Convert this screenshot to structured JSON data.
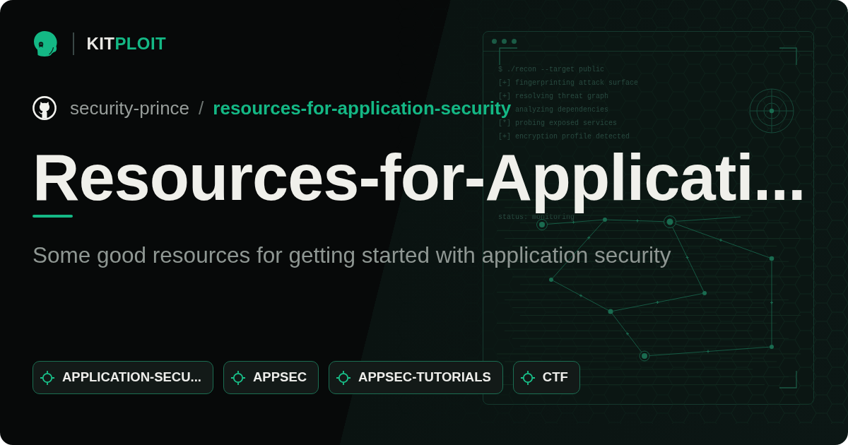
{
  "brand": {
    "prefix": "KIT",
    "suffix": "PLOIT"
  },
  "repository": {
    "owner": "security-prince",
    "separator": "/",
    "name": "resources-for-application-security"
  },
  "title": "Resources-for-Applicati...",
  "description": "Some good resources for getting started with application security",
  "topics": [
    "APPLICATION-SECU...",
    "APPSEC",
    "APPSEC-TUTORIALS",
    "CTF"
  ],
  "terminal": {
    "lines": [
      {
        "kind": "full",
        "text": "$ ./recon --target public"
      },
      {
        "kind": "full",
        "text": "[+] fingerprinting attack surface"
      },
      {
        "kind": "full",
        "text": "[+] resolving threat graph"
      },
      {
        "kind": "continued",
        "text": "analyzing dependencies"
      },
      {
        "kind": "full",
        "text": "[*] probing exposed services"
      },
      {
        "kind": "full",
        "text": "[+] encryption profile detected"
      }
    ],
    "status": "status: monitoring"
  }
}
